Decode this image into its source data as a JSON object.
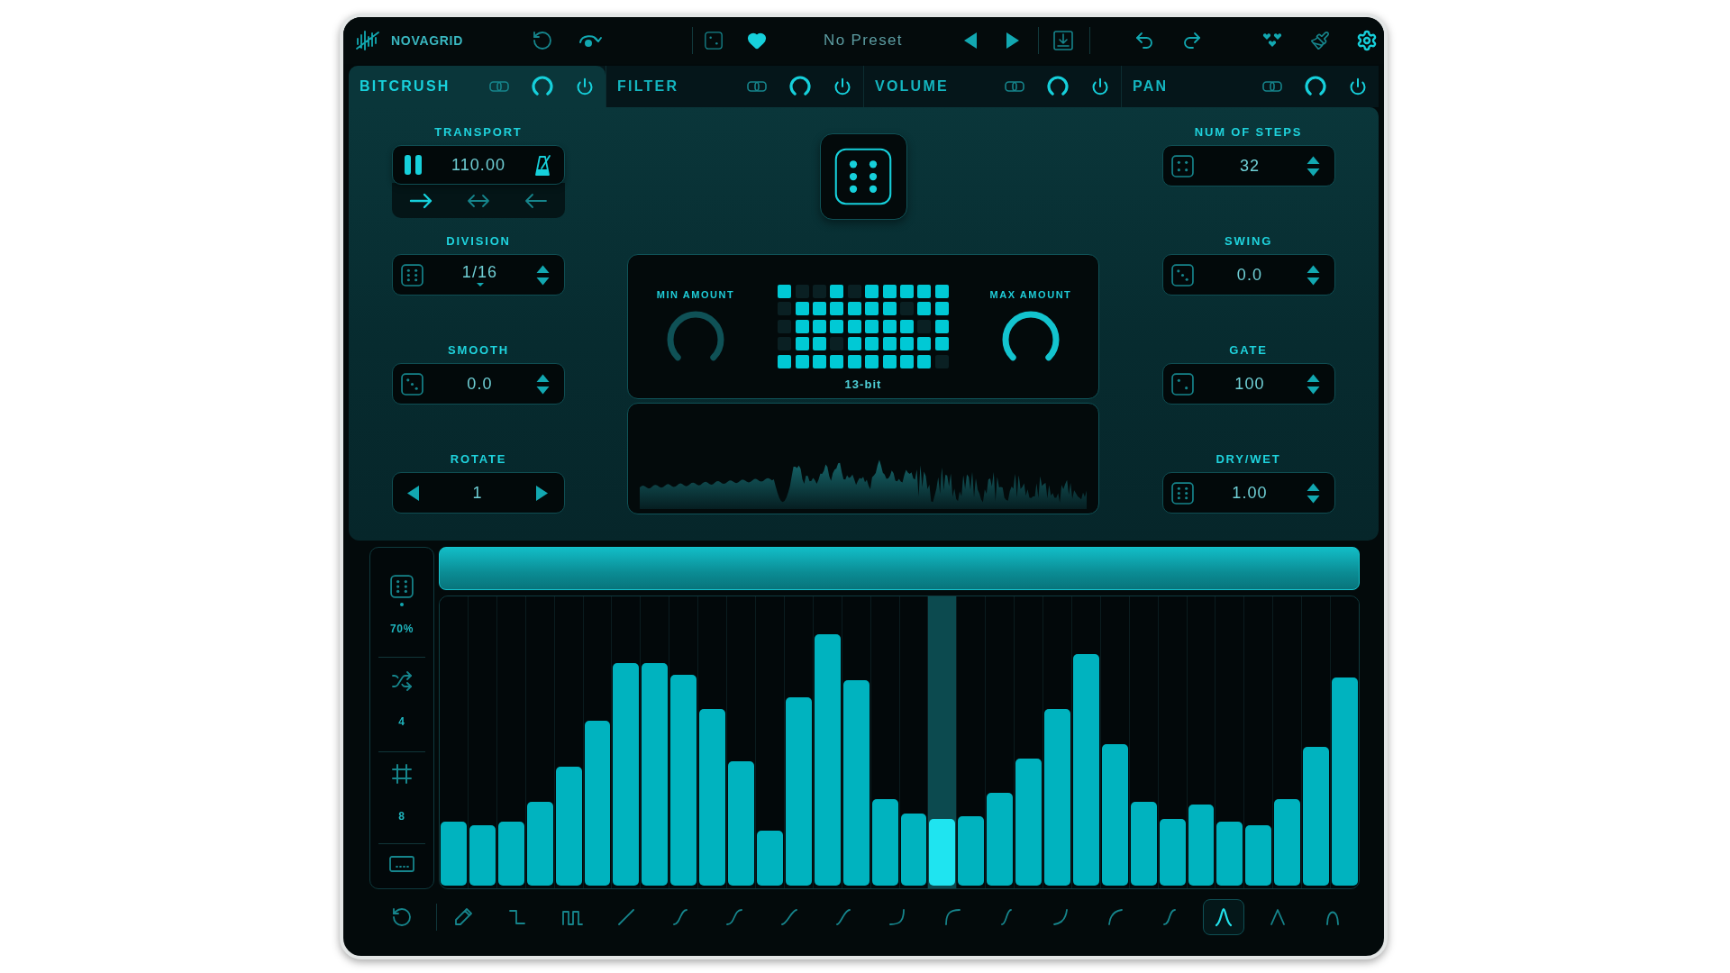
{
  "header": {
    "brand": "NOVAGRID",
    "preset": "No Preset",
    "favorite": true
  },
  "tabs": [
    {
      "label": "BITCRUSH",
      "selected": true
    },
    {
      "label": "FILTER",
      "selected": false
    },
    {
      "label": "VOLUME",
      "selected": false
    },
    {
      "label": "PAN",
      "selected": false
    }
  ],
  "transport": {
    "label": "TRANSPORT",
    "playing": true,
    "tempo": "110.00",
    "directions": [
      {
        "selected": true
      },
      {
        "selected": false
      },
      {
        "selected": false
      }
    ]
  },
  "left_controls": [
    {
      "label": "DIVISION",
      "value": "1/16",
      "kind": "dropdown"
    },
    {
      "label": "SMOOTH",
      "value": "0.0",
      "kind": "stepper"
    },
    {
      "label": "ROTATE",
      "value": "1",
      "kind": "arrows"
    }
  ],
  "bit_display": {
    "knobs": [
      {
        "label": "MIN AMOUNT",
        "active": false
      },
      {
        "label": "MAX AMOUNT",
        "active": true
      }
    ],
    "rows": [
      [
        true,
        false,
        false,
        true,
        false,
        true,
        true,
        true,
        true,
        true
      ],
      [
        false,
        true,
        true,
        true,
        true,
        true,
        true,
        false,
        true,
        true
      ],
      [
        false,
        true,
        true,
        true,
        true,
        true,
        true,
        true,
        false,
        true
      ],
      [
        false,
        true,
        true,
        false,
        true,
        true,
        true,
        true,
        true,
        true
      ],
      [
        true,
        true,
        true,
        true,
        true,
        true,
        true,
        true,
        true,
        false
      ]
    ],
    "caption": "13-bit"
  },
  "right_controls": [
    {
      "label": "NUM OF STEPS",
      "value": "32",
      "kind": "stepper"
    },
    {
      "label": "SWING",
      "value": "0.0",
      "kind": "stepper"
    },
    {
      "label": "GATE",
      "value": "100",
      "kind": "stepper"
    },
    {
      "label": "DRY/WET",
      "value": "1.00",
      "kind": "stepper"
    }
  ],
  "sidebar": {
    "values": [
      "70%",
      "4",
      "8"
    ]
  },
  "steps": [
    {
      "level": 0.22,
      "current": false
    },
    {
      "level": 0.21,
      "current": false
    },
    {
      "level": 0.22,
      "current": false
    },
    {
      "level": 0.29,
      "current": false
    },
    {
      "level": 0.41,
      "current": false
    },
    {
      "level": 0.57,
      "current": false
    },
    {
      "level": 0.77,
      "current": false
    },
    {
      "level": 0.77,
      "current": false
    },
    {
      "level": 0.73,
      "current": false
    },
    {
      "level": 0.61,
      "current": false
    },
    {
      "level": 0.43,
      "current": false
    },
    {
      "level": 0.19,
      "current": false
    },
    {
      "level": 0.65,
      "current": false
    },
    {
      "level": 0.87,
      "current": false
    },
    {
      "level": 0.71,
      "current": false
    },
    {
      "level": 0.3,
      "current": false
    },
    {
      "level": 0.25,
      "current": false
    },
    {
      "level": 0.23,
      "current": true
    },
    {
      "level": 0.24,
      "current": false
    },
    {
      "level": 0.32,
      "current": false
    },
    {
      "level": 0.44,
      "current": false
    },
    {
      "level": 0.61,
      "current": false
    },
    {
      "level": 0.8,
      "current": false
    },
    {
      "level": 0.49,
      "current": false
    },
    {
      "level": 0.29,
      "current": false
    },
    {
      "level": 0.23,
      "current": false
    },
    {
      "level": 0.28,
      "current": false
    },
    {
      "level": 0.22,
      "current": false
    },
    {
      "level": 0.21,
      "current": false
    },
    {
      "level": 0.3,
      "current": false
    },
    {
      "level": 0.48,
      "current": false
    },
    {
      "level": 0.72,
      "current": false
    }
  ],
  "tools": [
    {
      "selected": false
    },
    {
      "selected": false
    },
    {
      "selected": false
    },
    {
      "selected": false
    },
    {
      "selected": false
    },
    {
      "selected": false
    },
    {
      "selected": false
    },
    {
      "selected": false
    },
    {
      "selected": false
    },
    {
      "selected": false
    },
    {
      "selected": false
    },
    {
      "selected": false
    },
    {
      "selected": false
    },
    {
      "selected": false
    },
    {
      "selected": true
    },
    {
      "selected": false
    },
    {
      "selected": false
    }
  ]
}
